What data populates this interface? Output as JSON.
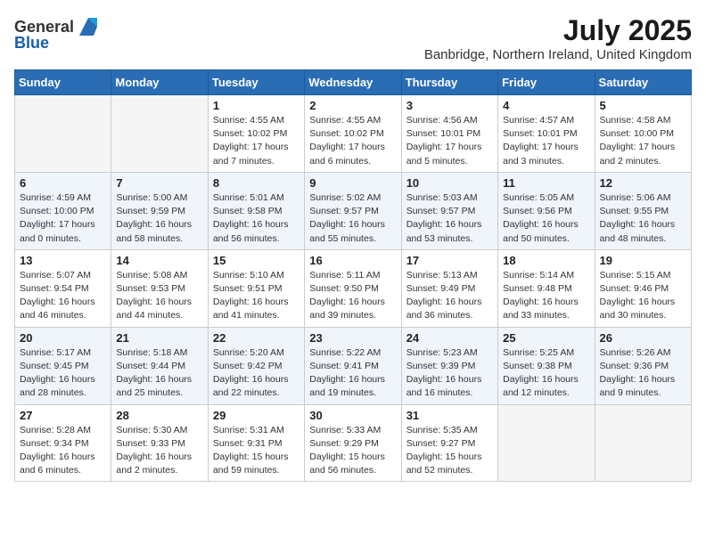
{
  "logo": {
    "general": "General",
    "blue": "Blue"
  },
  "title": "July 2025",
  "subtitle": "Banbridge, Northern Ireland, United Kingdom",
  "weekdays": [
    "Sunday",
    "Monday",
    "Tuesday",
    "Wednesday",
    "Thursday",
    "Friday",
    "Saturday"
  ],
  "weeks": [
    [
      {
        "day": "",
        "info": ""
      },
      {
        "day": "",
        "info": ""
      },
      {
        "day": "1",
        "info": "Sunrise: 4:55 AM\nSunset: 10:02 PM\nDaylight: 17 hours\nand 7 minutes."
      },
      {
        "day": "2",
        "info": "Sunrise: 4:55 AM\nSunset: 10:02 PM\nDaylight: 17 hours\nand 6 minutes."
      },
      {
        "day": "3",
        "info": "Sunrise: 4:56 AM\nSunset: 10:01 PM\nDaylight: 17 hours\nand 5 minutes."
      },
      {
        "day": "4",
        "info": "Sunrise: 4:57 AM\nSunset: 10:01 PM\nDaylight: 17 hours\nand 3 minutes."
      },
      {
        "day": "5",
        "info": "Sunrise: 4:58 AM\nSunset: 10:00 PM\nDaylight: 17 hours\nand 2 minutes."
      }
    ],
    [
      {
        "day": "6",
        "info": "Sunrise: 4:59 AM\nSunset: 10:00 PM\nDaylight: 17 hours\nand 0 minutes."
      },
      {
        "day": "7",
        "info": "Sunrise: 5:00 AM\nSunset: 9:59 PM\nDaylight: 16 hours\nand 58 minutes."
      },
      {
        "day": "8",
        "info": "Sunrise: 5:01 AM\nSunset: 9:58 PM\nDaylight: 16 hours\nand 56 minutes."
      },
      {
        "day": "9",
        "info": "Sunrise: 5:02 AM\nSunset: 9:57 PM\nDaylight: 16 hours\nand 55 minutes."
      },
      {
        "day": "10",
        "info": "Sunrise: 5:03 AM\nSunset: 9:57 PM\nDaylight: 16 hours\nand 53 minutes."
      },
      {
        "day": "11",
        "info": "Sunrise: 5:05 AM\nSunset: 9:56 PM\nDaylight: 16 hours\nand 50 minutes."
      },
      {
        "day": "12",
        "info": "Sunrise: 5:06 AM\nSunset: 9:55 PM\nDaylight: 16 hours\nand 48 minutes."
      }
    ],
    [
      {
        "day": "13",
        "info": "Sunrise: 5:07 AM\nSunset: 9:54 PM\nDaylight: 16 hours\nand 46 minutes."
      },
      {
        "day": "14",
        "info": "Sunrise: 5:08 AM\nSunset: 9:53 PM\nDaylight: 16 hours\nand 44 minutes."
      },
      {
        "day": "15",
        "info": "Sunrise: 5:10 AM\nSunset: 9:51 PM\nDaylight: 16 hours\nand 41 minutes."
      },
      {
        "day": "16",
        "info": "Sunrise: 5:11 AM\nSunset: 9:50 PM\nDaylight: 16 hours\nand 39 minutes."
      },
      {
        "day": "17",
        "info": "Sunrise: 5:13 AM\nSunset: 9:49 PM\nDaylight: 16 hours\nand 36 minutes."
      },
      {
        "day": "18",
        "info": "Sunrise: 5:14 AM\nSunset: 9:48 PM\nDaylight: 16 hours\nand 33 minutes."
      },
      {
        "day": "19",
        "info": "Sunrise: 5:15 AM\nSunset: 9:46 PM\nDaylight: 16 hours\nand 30 minutes."
      }
    ],
    [
      {
        "day": "20",
        "info": "Sunrise: 5:17 AM\nSunset: 9:45 PM\nDaylight: 16 hours\nand 28 minutes."
      },
      {
        "day": "21",
        "info": "Sunrise: 5:18 AM\nSunset: 9:44 PM\nDaylight: 16 hours\nand 25 minutes."
      },
      {
        "day": "22",
        "info": "Sunrise: 5:20 AM\nSunset: 9:42 PM\nDaylight: 16 hours\nand 22 minutes."
      },
      {
        "day": "23",
        "info": "Sunrise: 5:22 AM\nSunset: 9:41 PM\nDaylight: 16 hours\nand 19 minutes."
      },
      {
        "day": "24",
        "info": "Sunrise: 5:23 AM\nSunset: 9:39 PM\nDaylight: 16 hours\nand 16 minutes."
      },
      {
        "day": "25",
        "info": "Sunrise: 5:25 AM\nSunset: 9:38 PM\nDaylight: 16 hours\nand 12 minutes."
      },
      {
        "day": "26",
        "info": "Sunrise: 5:26 AM\nSunset: 9:36 PM\nDaylight: 16 hours\nand 9 minutes."
      }
    ],
    [
      {
        "day": "27",
        "info": "Sunrise: 5:28 AM\nSunset: 9:34 PM\nDaylight: 16 hours\nand 6 minutes."
      },
      {
        "day": "28",
        "info": "Sunrise: 5:30 AM\nSunset: 9:33 PM\nDaylight: 16 hours\nand 2 minutes."
      },
      {
        "day": "29",
        "info": "Sunrise: 5:31 AM\nSunset: 9:31 PM\nDaylight: 15 hours\nand 59 minutes."
      },
      {
        "day": "30",
        "info": "Sunrise: 5:33 AM\nSunset: 9:29 PM\nDaylight: 15 hours\nand 56 minutes."
      },
      {
        "day": "31",
        "info": "Sunrise: 5:35 AM\nSunset: 9:27 PM\nDaylight: 15 hours\nand 52 minutes."
      },
      {
        "day": "",
        "info": ""
      },
      {
        "day": "",
        "info": ""
      }
    ]
  ]
}
